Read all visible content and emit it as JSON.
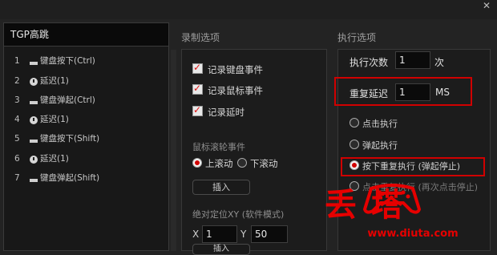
{
  "left": {
    "macro_name": "TGP高跳",
    "steps": [
      {
        "num": "1",
        "icon": "keyboard-icon",
        "text": "键盘按下(Ctrl)"
      },
      {
        "num": "2",
        "icon": "clock-icon",
        "text": "延迟(1)"
      },
      {
        "num": "3",
        "icon": "keyboard-icon",
        "text": "键盘弹起(Ctrl)"
      },
      {
        "num": "4",
        "icon": "clock-icon",
        "text": "延迟(1)"
      },
      {
        "num": "5",
        "icon": "keyboard-icon",
        "text": "键盘按下(Shift)"
      },
      {
        "num": "6",
        "icon": "clock-icon",
        "text": "延迟(1)"
      },
      {
        "num": "7",
        "icon": "keyboard-icon",
        "text": "键盘弹起(Shift)"
      }
    ]
  },
  "record": {
    "title": "录制选项",
    "options": [
      "记录键盘事件",
      "记录鼠标事件",
      "记录延时"
    ],
    "wheel_label": "鼠标滚轮事件",
    "wheel_up": "上滚动",
    "wheel_down": "下滚动",
    "insert_label": "插入",
    "abs_label": "绝对定位XY (软件模式)",
    "x_label": "X",
    "x_value": "1",
    "y_label": "Y",
    "y_value": "50",
    "insert2_label": "插入"
  },
  "exec": {
    "title": "执行选项",
    "count_label": "执行次数",
    "count_value": "1",
    "count_unit": "次",
    "delay_label": "重复延迟",
    "delay_value": "1",
    "delay_unit": "MS",
    "modes": [
      "点击执行",
      "弹起执行",
      "按下重复执行 (弹起停止)",
      "点击重复执行 (再次点击停止)"
    ],
    "selected_mode": 2
  },
  "watermark": {
    "text": "丢 塔",
    "url": "www.diuta.com"
  },
  "colors": {
    "accent": "#d00000",
    "bg": "#232323"
  }
}
